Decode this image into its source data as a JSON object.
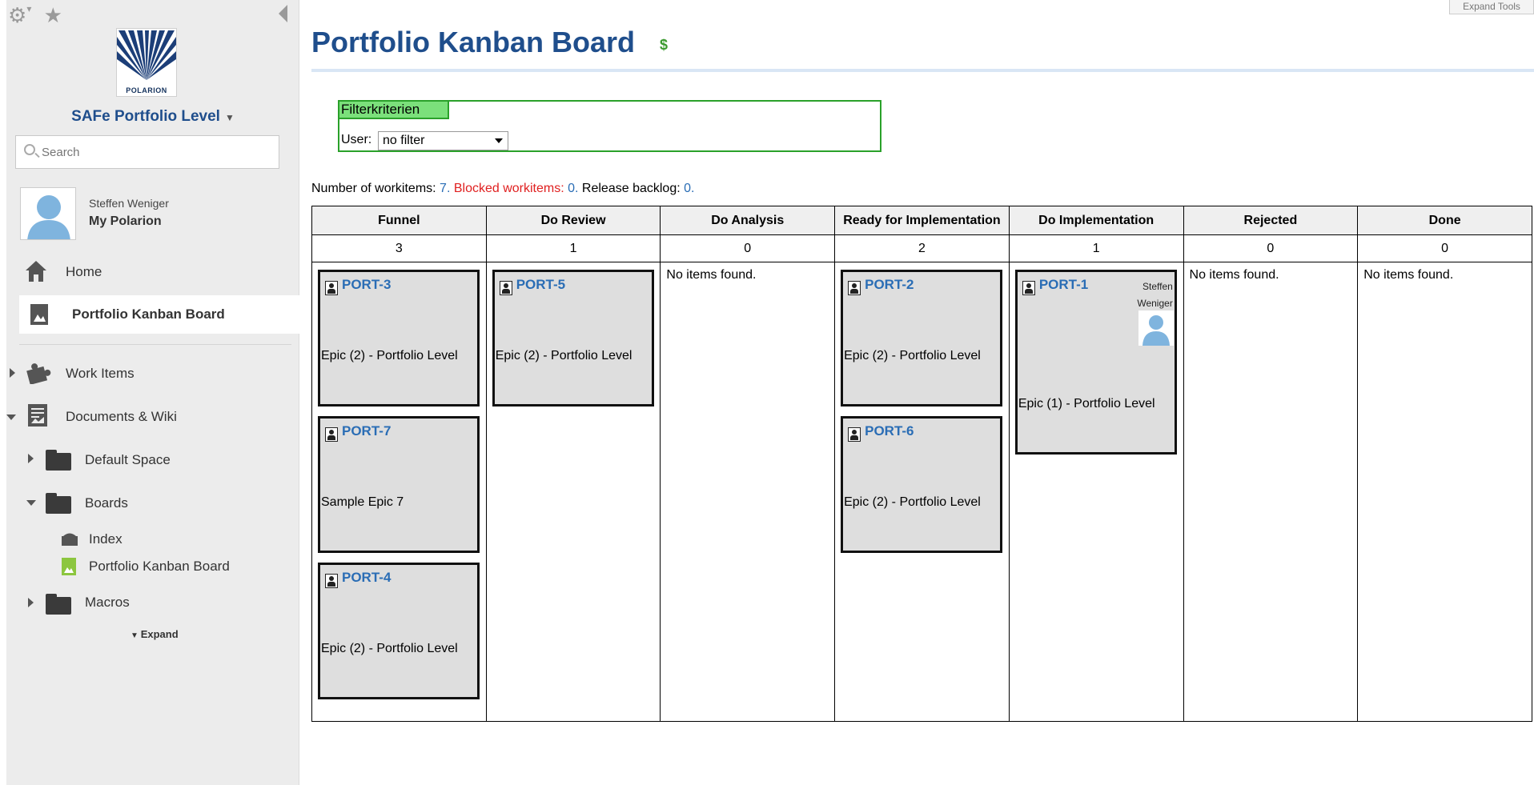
{
  "sidebar": {
    "logo_text": "POLARION",
    "project": "SAFe Portfolio Level",
    "search_placeholder": "Search",
    "user": {
      "name": "Steffen Weniger",
      "link": "My Polarion"
    },
    "nav": {
      "home": "Home",
      "portfolio_board": "Portfolio Kanban Board",
      "work_items": "Work Items",
      "documents_wiki": "Documents & Wiki",
      "default_space": "Default Space",
      "boards": "Boards",
      "index": "Index",
      "boards_portfolio": "Portfolio Kanban Board",
      "macros": "Macros",
      "expand": "Expand"
    }
  },
  "header": {
    "title": "Portfolio Kanban Board",
    "refresh_icon": "$",
    "expand_tools": "Expand Tools"
  },
  "filter": {
    "legend": "Filterkriterien",
    "user_label": "User:",
    "user_value": "no filter"
  },
  "summary": {
    "workitems_label": "Number of workitems:",
    "workitems_value": "7.",
    "blocked_label": "Blocked workitems:",
    "blocked_value": "0.",
    "backlog_label": "Release backlog:",
    "backlog_value": "0."
  },
  "board": {
    "columns": [
      {
        "name": "Funnel",
        "count": "3"
      },
      {
        "name": "Do Review",
        "count": "1"
      },
      {
        "name": "Do Analysis",
        "count": "0"
      },
      {
        "name": "Ready for Implementation",
        "count": "2"
      },
      {
        "name": "Do Implementation",
        "count": "1"
      },
      {
        "name": "Rejected",
        "count": "0"
      },
      {
        "name": "Done",
        "count": "0"
      }
    ],
    "no_items": "No items found.",
    "cards": {
      "port3": {
        "id": "PORT-3",
        "text": "Epic (2) - Portfolio Level"
      },
      "port7": {
        "id": "PORT-7",
        "text": "Sample Epic 7"
      },
      "port4": {
        "id": "PORT-4",
        "text": "Epic (2) - Portfolio Level"
      },
      "port5": {
        "id": "PORT-5",
        "text": "Epic (2) - Portfolio Level"
      },
      "port2": {
        "id": "PORT-2",
        "text": "Epic (2) - Portfolio Level"
      },
      "port6": {
        "id": "PORT-6",
        "text": "Epic (2) - Portfolio Level"
      },
      "port1": {
        "id": "PORT-1",
        "text": "Epic (1) - Portfolio Level",
        "assignee_first": "Steffen",
        "assignee_last": "Weniger"
      }
    }
  }
}
